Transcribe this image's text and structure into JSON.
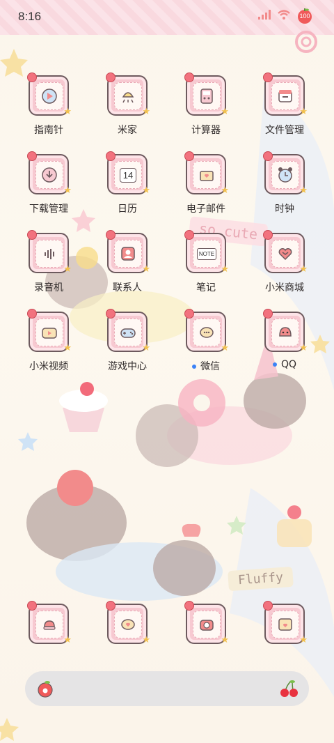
{
  "status_bar": {
    "time": "8:16",
    "battery": "100"
  },
  "apps": [
    {
      "label": "指南针",
      "icon": "compass-icon",
      "notification_dot": false
    },
    {
      "label": "米家",
      "icon": "mi-home-icon",
      "notification_dot": false
    },
    {
      "label": "计算器",
      "icon": "calculator-icon",
      "notification_dot": false
    },
    {
      "label": "文件管理",
      "icon": "file-manager-icon",
      "notification_dot": false
    },
    {
      "label": "下载管理",
      "icon": "download-manager-icon",
      "notification_dot": false
    },
    {
      "label": "日历",
      "icon": "calendar-icon",
      "notification_dot": false,
      "badge": "14"
    },
    {
      "label": "电子邮件",
      "icon": "email-icon",
      "notification_dot": false
    },
    {
      "label": "时钟",
      "icon": "clock-icon",
      "notification_dot": false
    },
    {
      "label": "录音机",
      "icon": "recorder-icon",
      "notification_dot": false
    },
    {
      "label": "联系人",
      "icon": "contacts-icon",
      "notification_dot": false
    },
    {
      "label": "笔记",
      "icon": "notes-icon",
      "notification_dot": false,
      "badge": "NOTE"
    },
    {
      "label": "小米商城",
      "icon": "mi-store-icon",
      "notification_dot": false
    },
    {
      "label": "小米视频",
      "icon": "video-icon",
      "notification_dot": false
    },
    {
      "label": "游戏中心",
      "icon": "game-center-icon",
      "notification_dot": false
    },
    {
      "label": "微信",
      "icon": "wechat-icon",
      "notification_dot": true
    },
    {
      "label": "QQ",
      "icon": "qq-icon",
      "notification_dot": true
    }
  ],
  "dock": [
    {
      "icon": "phone-icon"
    },
    {
      "icon": "messages-icon"
    },
    {
      "icon": "camera-icon"
    },
    {
      "icon": "browser-icon"
    }
  ],
  "wallpaper_text": {
    "cute": "so cute",
    "fluffy": "Fluffy"
  },
  "colors": {
    "icon_bg": "#f7c9d1",
    "icon_border": "#6d5a5e",
    "notification_dot": "#3b82f6"
  }
}
